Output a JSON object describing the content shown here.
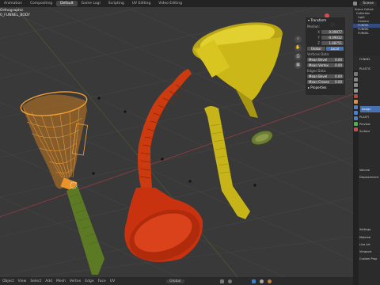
{
  "topbar": {
    "workspaces": [
      "Animation",
      "Compositing",
      "Default",
      "Game Logi",
      "Scripting",
      "UV Editing",
      "Video Editing"
    ],
    "active_workspace": "Default",
    "scene_label": "Scene"
  },
  "viewport": {
    "overlay_line1": "Orthographic",
    "overlay_line2": "0_FUNNEL_BODY",
    "bottom_menu": [
      "Object",
      "View",
      "Select",
      "Add",
      "Mesh",
      "Vertex",
      "Edge",
      "Face",
      "UV"
    ],
    "transform_orientation": "Global"
  },
  "npanel": {
    "title": "Transform",
    "median_label": "Median:",
    "rows": [
      {
        "label": "X",
        "value": "0.09977"
      },
      {
        "label": "Y",
        "value": "-0.09032"
      },
      {
        "label": "Z",
        "value": "1.68751"
      }
    ],
    "global_local": [
      "Global",
      "Local"
    ],
    "vertices_data_label": "Vertices Data:",
    "vertices_data": [
      {
        "label": "Mean Bevel",
        "value": "0.00"
      },
      {
        "label": "Mean Vertex",
        "value": "0.00"
      }
    ],
    "edges_data_label": "Edges Data:",
    "edges_data": [
      {
        "label": "Mean Bevel",
        "value": "0.00"
      },
      {
        "label": "Mean Crease",
        "value": "0.00"
      }
    ],
    "properties_label": "Properties"
  },
  "outliner": {
    "rows": [
      "Scene Collect",
      "Collection",
      "Light",
      "Camera",
      "FUNNEL",
      "FUNNEL",
      "FUNNEL"
    ]
  },
  "properties": {
    "object_name": "FUNNEL",
    "material_name": "PLASTIC",
    "assign_label": "Assign",
    "material_dropdown": "PLASTI",
    "preview_label": "Preview",
    "surface_label": "Surface",
    "sections": [
      "Volume",
      "Displacement",
      "Settings",
      "Material",
      "Line Art",
      "Viewport",
      "Custom Prop"
    ]
  },
  "colors": {
    "viewport_bg": "#393939",
    "yellow_funnel": "#d4c21a",
    "orange_funnel": "#e8932a",
    "red_funnel": "#c8320f",
    "accent_blue": "#4772b3"
  }
}
